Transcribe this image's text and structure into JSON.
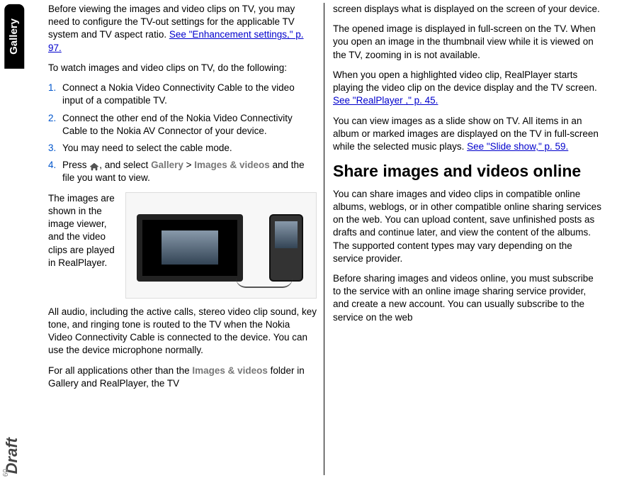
{
  "side_tab": "Gallery",
  "draft": "Draft",
  "page_number": "60",
  "left": {
    "p1a": "Before viewing the images and video clips on TV, you may need to configure the TV-out settings for the applicable TV system and TV aspect ratio. ",
    "p1_link": "See \"Enhancement settings,\" p. 97.",
    "p2": "To watch images and video clips on TV, do the following:",
    "steps": [
      "Connect a Nokia Video Connectivity Cable to the video input of a compatible TV.",
      "Connect the other end of the Nokia Video Connectivity Cable to the Nokia AV Connector of your device.",
      "You may need to select the cable mode."
    ],
    "step4_a": "Press ",
    "step4_b": ", and select ",
    "step4_path1": "Gallery",
    "step4_gt": " > ",
    "step4_path2": "Images & videos",
    "step4_c": " and the file you want to view.",
    "img_side": "The images are shown in the image viewer, and the video clips are played in RealPlayer.",
    "p3": "All audio, including the active calls, stereo video clip sound, key tone, and ringing tone is routed to the TV when the Nokia Video Connectivity Cable is connected to the device. You can use the device microphone normally.",
    "p4a": "For all applications other than the ",
    "p4_path": "Images & videos",
    "p4b": " folder in Gallery and RealPlayer, the TV"
  },
  "right": {
    "p1": "screen displays what is displayed on the screen of your device.",
    "p2": "The opened image is displayed in full-screen on the TV. When you open an image in the thumbnail view while it is viewed on the TV, zooming in is not available.",
    "p3a": "When you open a highlighted video clip, RealPlayer starts playing the video clip on the device display and the TV screen. ",
    "p3_link": "See \"RealPlayer ,\" p. 45.",
    "p4a": "You can view images as a slide show on TV. All items in an album or marked images are displayed on the TV in full-screen while the selected music plays. ",
    "p4_link": "See \"Slide show,\" p. 59.",
    "h2": "Share images and videos online",
    "p5": "You can share images and video clips in compatible online albums, weblogs, or in other compatible online sharing services on the web. You can upload content, save unfinished posts as drafts and continue later, and view the content of the albums. The supported content types may vary depending on the service provider.",
    "p6": "Before sharing images and videos online, you must subscribe to the service with an online image sharing service provider, and create a new account. You can usually subscribe to the service on the web"
  }
}
